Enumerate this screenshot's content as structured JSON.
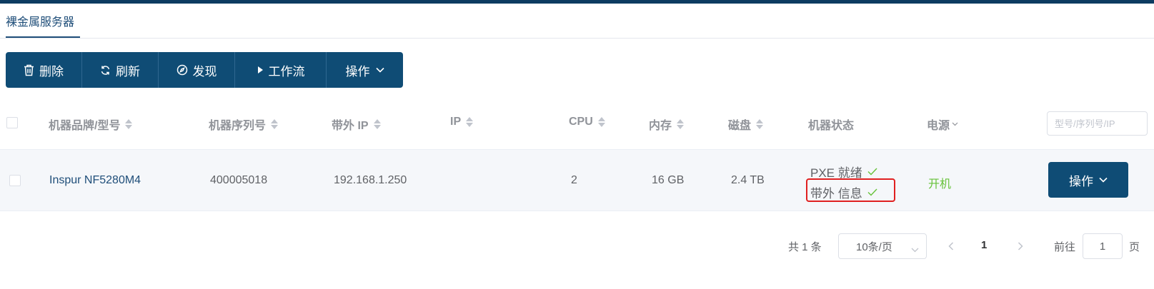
{
  "tabs": {
    "active": "裸金属服务器"
  },
  "toolbar": {
    "buttons": [
      {
        "label": "删除",
        "icon": "trash-icon"
      },
      {
        "label": "刷新",
        "icon": "refresh-icon"
      },
      {
        "label": "发现",
        "icon": "compass-icon"
      },
      {
        "label": "工作流",
        "icon": "play-icon"
      },
      {
        "label": "操作",
        "icon": "chevron-down-icon"
      }
    ]
  },
  "table": {
    "columns": [
      "机器品牌/型号",
      "机器序列号",
      "带外 IP",
      "IP",
      "CPU",
      "内存",
      "磁盘",
      "机器状态",
      "电源"
    ],
    "search_placeholder": "型号/序列号/IP",
    "rows": [
      {
        "brand": "Inspur NF5280M4",
        "serial": "400005018",
        "bmc_ip": "192.168.1.250",
        "ip": "",
        "cpu": "2",
        "memory": "16 GB",
        "disk": "2.4 TB",
        "status_pxe": "PXE 就绪",
        "status_oob": "带外 信息",
        "power": "开机",
        "action": "操作"
      }
    ]
  },
  "pagination": {
    "total": "共 1 条",
    "page_size": "10条/页",
    "current_page": "1",
    "goto_label": "前往",
    "goto_value": "1",
    "page_suffix": "页"
  },
  "colors": {
    "brand": "#0f4c75",
    "highlight": "#e02020",
    "success": "#67c23a"
  }
}
